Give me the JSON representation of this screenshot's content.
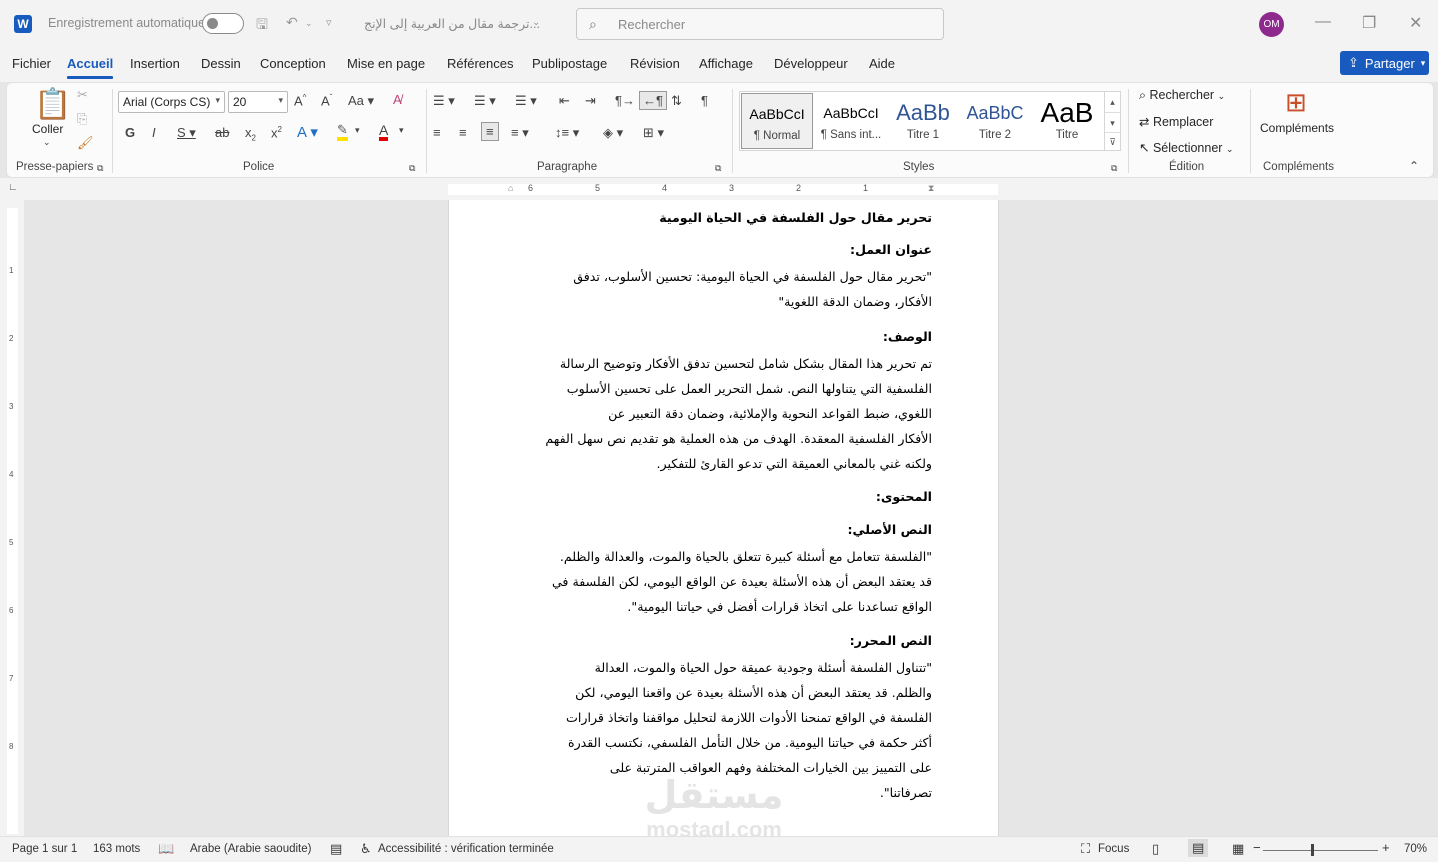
{
  "titlebar": {
    "autosave_label": "Enregistrement automatique",
    "doc_name": "ترجمة مقال من العربية إلى الإنج...",
    "search_placeholder": "Rechercher",
    "avatar_initials": "OM",
    "app_logo": "W"
  },
  "menu": {
    "tabs": [
      "Fichier",
      "Accueil",
      "Insertion",
      "Dessin",
      "Conception",
      "Mise en page",
      "Références",
      "Publipostage",
      "Révision",
      "Affichage",
      "Développeur",
      "Aide"
    ],
    "active_tab": "Accueil",
    "share_label": "Partager"
  },
  "ribbon": {
    "clipboard": {
      "paste_label": "Coller",
      "group_label": "Presse-papiers"
    },
    "font": {
      "font_name": "Arial (Corps CS)",
      "font_size": "20",
      "group_label": "Police"
    },
    "paragraph": {
      "group_label": "Paragraphe"
    },
    "styles": {
      "group_label": "Styles",
      "items": [
        {
          "preview": "AaBbCcI",
          "name": "¶ Normal"
        },
        {
          "preview": "AaBbCcI",
          "name": "¶ Sans int..."
        },
        {
          "preview": "AaBb",
          "name": "Titre 1"
        },
        {
          "preview": "AaBbC",
          "name": "Titre 2"
        },
        {
          "preview": "AaB",
          "name": "Titre"
        }
      ]
    },
    "editing": {
      "find": "Rechercher",
      "replace": "Remplacer",
      "select": "Sélectionner",
      "group_label": "Édition"
    },
    "addins": {
      "label": "Compléments",
      "group_label": "Compléments"
    }
  },
  "ruler": {
    "h_numbers": [
      "6",
      "5",
      "4",
      "3",
      "2",
      "1"
    ],
    "v_numbers": [
      "1",
      "2",
      "3",
      "4",
      "5",
      "6",
      "7",
      "8"
    ]
  },
  "document": {
    "lines": [
      "تحرير مقال حول الفلسفة في الحياة اليومية",
      "عنوان العمل:",
      "\"تحرير مقال حول الفلسفة في الحياة اليومية: تحسين الأسلوب، تدفق",
      "الأفكار، وضمان الدقة اللغوية\"",
      "الوصف:",
      "تم تحرير هذا المقال بشكل شامل لتحسين تدفق الأفكار وتوضيح الرسالة",
      "الفلسفية التي يتناولها النص. شمل التحرير العمل على تحسين الأسلوب",
      "اللغوي، ضبط القواعد النحوية والإملائية، وضمان دقة التعبير عن",
      "الأفكار الفلسفية المعقدة. الهدف من هذه العملية هو تقديم نص سهل الفهم",
      "ولكنه غني بالمعاني العميقة التي تدعو القارئ للتفكير.",
      "المحتوى:",
      "النص الأصلي:",
      "\"الفلسفة تتعامل مع أسئلة كبيرة تتعلق بالحياة والموت، والعدالة والظلم.",
      "قد يعتقد البعض أن هذه الأسئلة بعيدة عن الواقع اليومي، لكن الفلسفة في",
      "الواقع تساعدنا على اتخاذ قرارات أفضل في حياتنا اليومية\".",
      "النص المحرر:",
      "\"تتناول الفلسفة أسئلة وجودية عميقة حول الحياة والموت، العدالة",
      "والظلم. قد يعتقد البعض أن هذه الأسئلة بعيدة عن واقعنا اليومي، لكن",
      "الفلسفة في الواقع تمنحنا الأدوات اللازمة لتحليل مواقفنا واتخاذ قرارات",
      "أكثر حكمة في حياتنا اليومية. من خلال التأمل الفلسفي، نكتسب القدرة",
      "على التمييز بين الخيارات المختلفة وفهم العواقب المترتبة على",
      "تصرفاتنا\"."
    ],
    "watermark": {
      "arabic": "مستقل",
      "latin": "mostaql.com"
    }
  },
  "statusbar": {
    "page": "Page 1 sur 1",
    "words": "163 mots",
    "language": "Arabe (Arabie saoudite)",
    "accessibility": "Accessibilité : vérification terminée",
    "focus": "Focus",
    "zoom": "70%"
  }
}
